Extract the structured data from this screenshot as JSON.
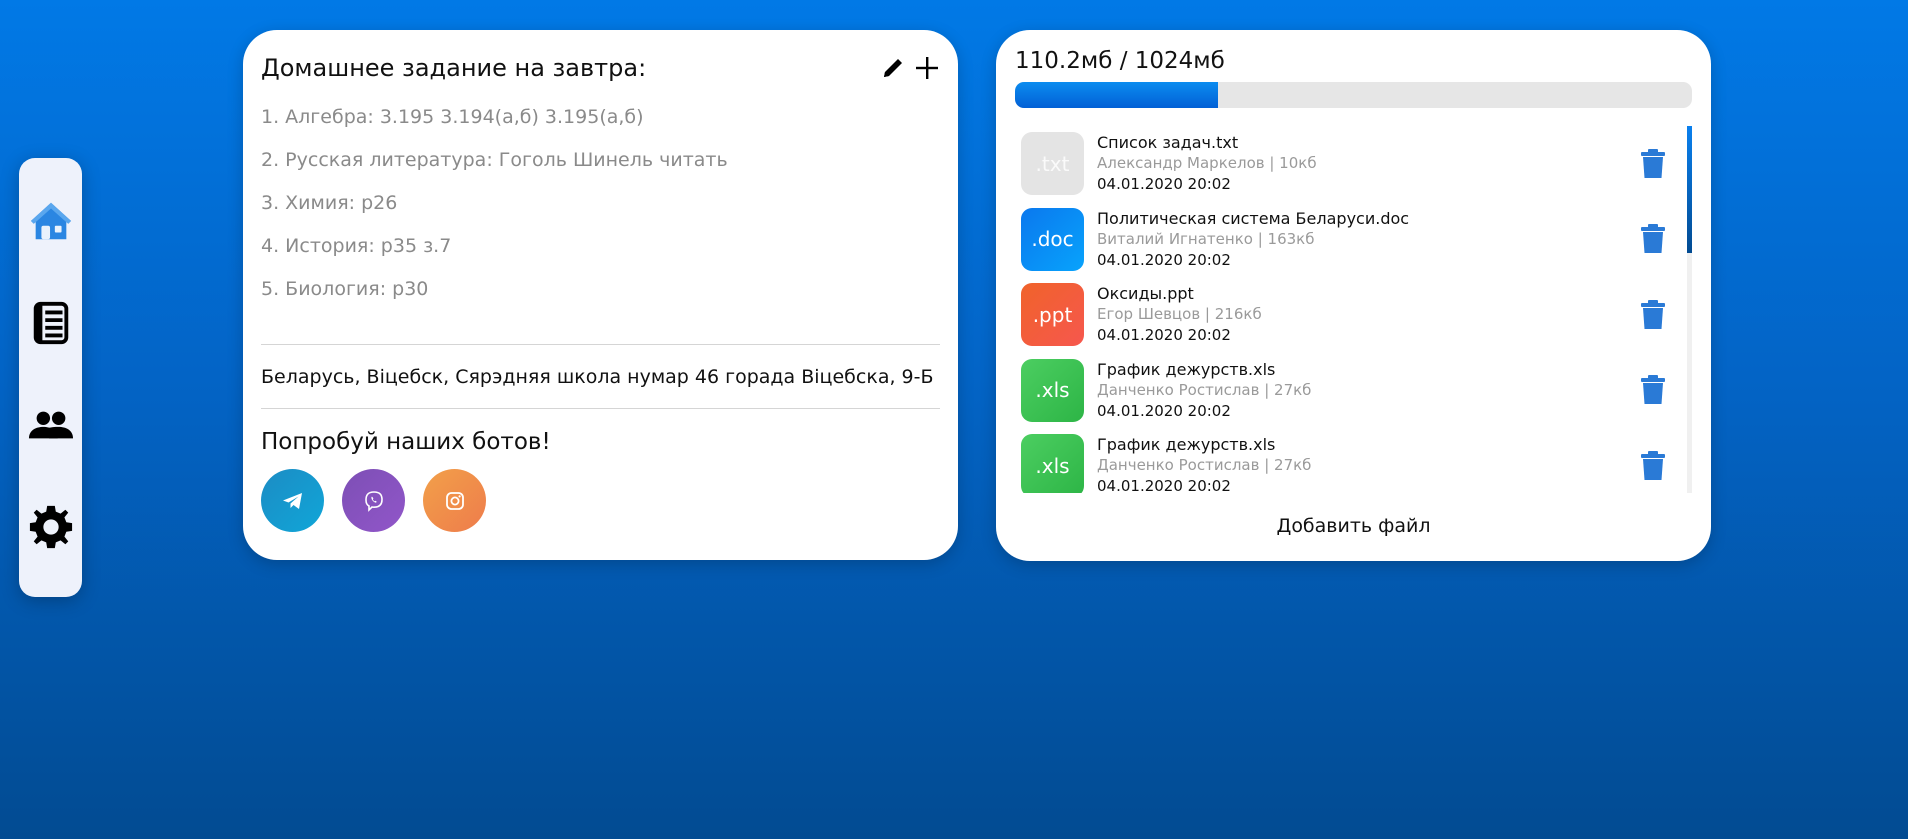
{
  "sidebar": {
    "items": [
      {
        "name": "home",
        "icon": "home-icon",
        "color": "#2a86e2"
      },
      {
        "name": "journal",
        "icon": "book-icon",
        "color": "#000000"
      },
      {
        "name": "classmates",
        "icon": "people-icon",
        "color": "#000000"
      },
      {
        "name": "settings",
        "icon": "gear-icon",
        "color": "#000000"
      }
    ]
  },
  "homework": {
    "title": "Домашнее задание на завтра:",
    "items": [
      "1. Алгебра: 3.195 3.194(а,б) 3.195(а,б)",
      "2. Русская литература: Гоголь Шинель читать",
      "3. Химия: р26",
      "4. История: р35 з.7",
      "5. Биология: р30"
    ],
    "school": "Беларусь, Віцебск, Сярэдняя школа нумар 46 горада Віцебска, 9-Б",
    "bots_title": "Попробуй наших ботов!",
    "bots": [
      {
        "name": "telegram",
        "icon": "telegram-icon"
      },
      {
        "name": "viber",
        "icon": "viber-icon"
      },
      {
        "name": "instagram",
        "icon": "instagram-icon"
      }
    ]
  },
  "files": {
    "storage_text": "110.2мб / 1024мб",
    "used_mb": 110.2,
    "total_mb": 1024,
    "progress_fraction": 0.3,
    "list": [
      {
        "ext": ".txt",
        "type": "txt",
        "name": "Список задач.txt",
        "sub": "Александр Маркелов | 10кб",
        "date": "04.01.2020 20:02"
      },
      {
        "ext": ".doc",
        "type": "doc",
        "name": "Политическая система Беларуси.doc",
        "sub": "Виталий Игнатенко | 163кб",
        "date": "04.01.2020 20:02"
      },
      {
        "ext": ".ppt",
        "type": "ppt",
        "name": "Оксиды.ppt",
        "sub": "Егор Шевцов | 216кб",
        "date": "04.01.2020 20:02"
      },
      {
        "ext": ".xls",
        "type": "xls",
        "name": "График дежурств.xls",
        "sub": "Данченко Ростислав | 27кб",
        "date": "04.01.2020 20:02"
      },
      {
        "ext": ".xls",
        "type": "xls",
        "name": "График дежурств.xls",
        "sub": "Данченко Ростислав | 27кб",
        "date": "04.01.2020 20:02"
      }
    ],
    "add_label": "Добавить файл",
    "trash_color": "#2a7ad6"
  }
}
